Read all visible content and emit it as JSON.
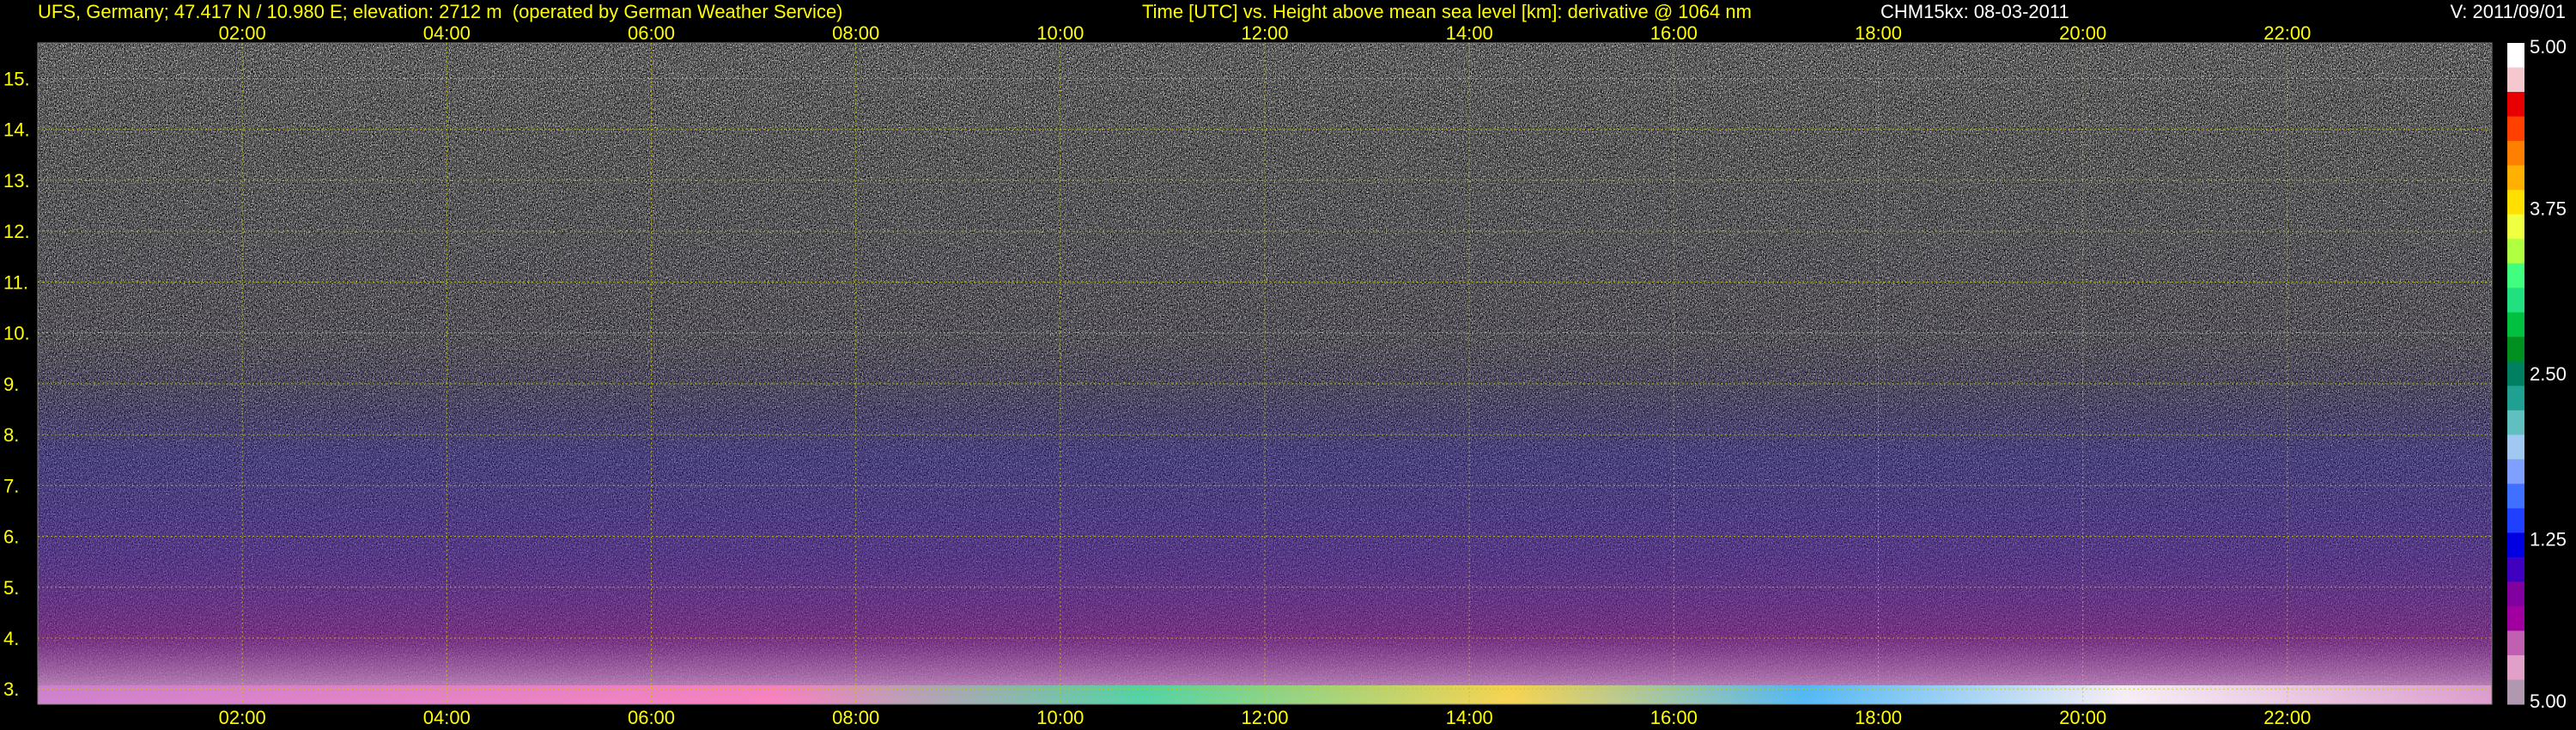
{
  "header": {
    "station": "UFS, Germany; 47.417 N / 10.980 E; elevation: 2712 m  (operated by German Weather Service)",
    "title": "Time [UTC] vs. Height above mean sea level [km]: derivative @ 1064 nm",
    "instrument": "CHM15kx: 08-03-2011",
    "version": "V: 2011/09/01"
  },
  "colors": {
    "text": "#ffff00",
    "grid": "#c8c800",
    "background": "#000000"
  },
  "chart_data": {
    "type": "heatmap",
    "title": "Time [UTC] vs. Height above mean sea level [km]: derivative @ 1064 nm",
    "xlabel": "Time [UTC]",
    "ylabel": "Height above mean sea level [km]",
    "x_range_hours": [
      0,
      24
    ],
    "y_range_km": [
      2.7,
      15.7
    ],
    "x_ticks": [
      "02:00",
      "04:00",
      "06:00",
      "08:00",
      "10:00",
      "12:00",
      "14:00",
      "16:00",
      "18:00",
      "20:00",
      "22:00"
    ],
    "x_tick_hours": [
      2,
      4,
      6,
      8,
      10,
      12,
      14,
      16,
      18,
      20,
      22
    ],
    "y_ticks": [
      "3.",
      "4.",
      "5.",
      "6.",
      "7.",
      "8.",
      "9.",
      "10.",
      "11.",
      "12.",
      "13.",
      "14.",
      "15."
    ],
    "y_tick_values": [
      3,
      4,
      5,
      6,
      7,
      8,
      9,
      10,
      11,
      12,
      13,
      14,
      15
    ],
    "grid": true,
    "colorbar": {
      "labels": [
        "5.00",
        "3.75",
        "2.50",
        "1.25",
        "5.00"
      ],
      "label_values": [
        5.0,
        3.75,
        2.5,
        1.25,
        0.0
      ],
      "colors_top_to_bottom": [
        "#ffffff",
        "#f4c8cc",
        "#e80000",
        "#ff4000",
        "#ff8000",
        "#ffb000",
        "#ffe000",
        "#f0ff40",
        "#b0ff40",
        "#40ff80",
        "#20e080",
        "#00c040",
        "#009020",
        "#008060",
        "#20a090",
        "#60c0c0",
        "#a0c8f0",
        "#80a0ff",
        "#4070ff",
        "#2040ff",
        "#0000e0",
        "#4000c0",
        "#8000a0",
        "#a000a0",
        "#c060b0",
        "#e0a0c8",
        "#b098b0"
      ]
    }
  }
}
